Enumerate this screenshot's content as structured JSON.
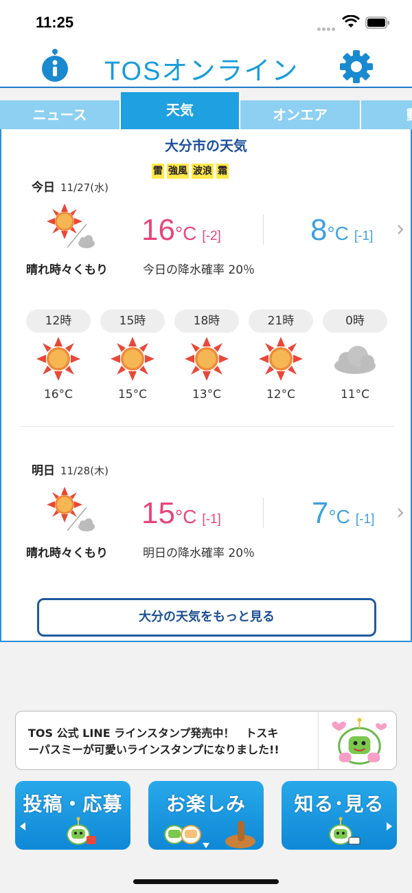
{
  "status_bar": {
    "time": "11:25"
  },
  "header": {
    "logo": "TOSオンライン"
  },
  "tabs": [
    {
      "label": "ニュース"
    },
    {
      "label": "天気"
    },
    {
      "label": "オンエア"
    },
    {
      "label": "動"
    }
  ],
  "weather": {
    "title": "大分市の天気",
    "warnings": [
      "雷",
      "強風",
      "波浪",
      "霜"
    ],
    "today": {
      "label": "今日",
      "date": "11/27(水)",
      "condition": "晴れ時々くもり",
      "high": "16",
      "high_diff": "[-2]",
      "low": "8",
      "low_diff": "[-1]",
      "unit": "°C",
      "rain": "今日の降水確率 20％"
    },
    "hourly": [
      {
        "time": "12時",
        "temp": "16°C",
        "icon": "sunny-icon"
      },
      {
        "time": "15時",
        "temp": "15°C",
        "icon": "sunny-icon"
      },
      {
        "time": "18時",
        "temp": "13°C",
        "icon": "sunny-icon"
      },
      {
        "time": "21時",
        "temp": "12°C",
        "icon": "sunny-icon"
      },
      {
        "time": "0時",
        "temp": "11°C",
        "icon": "cloudy-icon"
      }
    ],
    "tomorrow": {
      "label": "明日",
      "date": "11/28(木)",
      "condition": "晴れ時々くもり",
      "high": "15",
      "high_diff": "[-1]",
      "low": "7",
      "low_diff": "[-1]",
      "unit": "°C",
      "rain": "明日の降水確率 20％"
    },
    "more_button": "大分の天気をもっと見る"
  },
  "banner": {
    "line1": "TOS 公式 LINE ラインスタンプ発売中！　トスキ",
    "line2": "ーパスミーが可愛いラインスタンプになりました!!"
  },
  "nav": [
    {
      "label": "投稿・応募"
    },
    {
      "label": "お楽しみ"
    },
    {
      "label": "知る･見る"
    }
  ],
  "colors": {
    "accent": "#1fa0e0",
    "high_temp": "#e8457a",
    "low_temp": "#3ea0e0",
    "warning": "#ffe84a"
  }
}
